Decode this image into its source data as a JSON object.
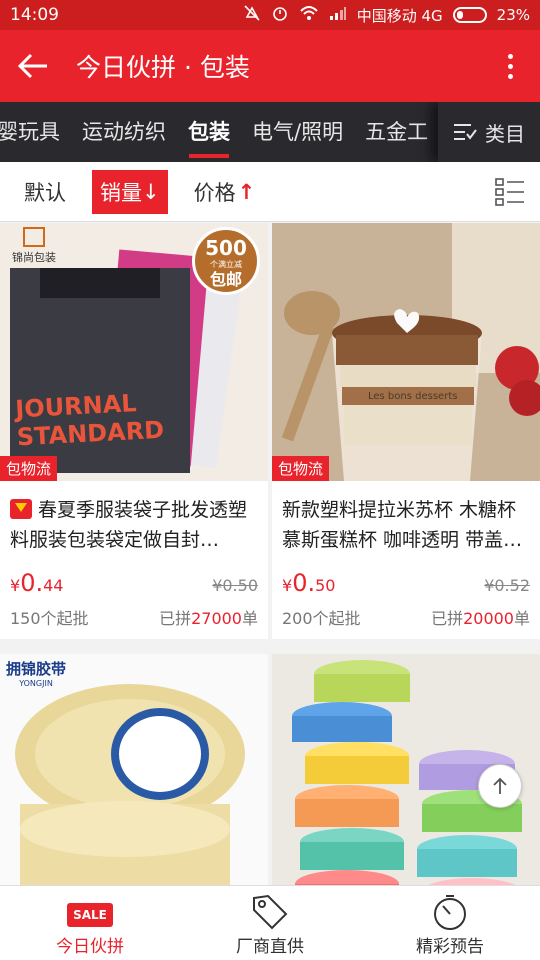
{
  "status": {
    "time": "14:09",
    "carrier": "中国移动 4G",
    "battery": "23%"
  },
  "header": {
    "title": "今日伙拼 · 包装"
  },
  "categories": [
    "婴玩具",
    "运动纺织",
    "包装",
    "电气/照明",
    "五金工"
  ],
  "category_more_label": "类目",
  "sort": {
    "default": "默认",
    "sales": "销量",
    "sales_arrow": "↓",
    "price": "价格",
    "price_arrow": "↑"
  },
  "products": [
    {
      "title": "春夏季服装袋子批发透塑料服装包装袋定做自封…",
      "price_symbol": "¥",
      "price_int": "0.",
      "price_dec": "44",
      "old_price": "¥0.50",
      "moq": "150个起批",
      "sold_prefix": "已拼",
      "sold_count": "27000",
      "sold_suffix": "单",
      "badge": "包物流",
      "has_brand_icon": true,
      "img_brand": "锦尚包装",
      "img_promo_number": "500",
      "img_promo_small": "个满立减",
      "img_promo_text": "包邮",
      "img_shirt_text": "JOURNAL STANDARD"
    },
    {
      "title": "新款塑料提拉米苏杯 木糖杯慕斯蛋糕杯 咖啡透明 带盖…",
      "price_symbol": "¥",
      "price_int": "0.",
      "price_dec": "50",
      "old_price": "¥0.52",
      "moq": "200个起批",
      "sold_prefix": "已拼",
      "sold_count": "20000",
      "sold_suffix": "单",
      "badge": "包物流",
      "has_brand_icon": false,
      "img_cup_text": "Les bons desserts"
    },
    {
      "img_brand": "拥锦胶带",
      "img_brand_sub": "YONGJIN"
    },
    {}
  ],
  "bottom_nav": [
    {
      "label": "今日伙拼",
      "icon": "sale-icon",
      "icon_text": "SALE"
    },
    {
      "label": "厂商直供",
      "icon": "tag-icon"
    },
    {
      "label": "精彩预告",
      "icon": "stopwatch-icon"
    }
  ],
  "colors": {
    "brand_red": "#e8232c",
    "dark_bar": "#2a2a2e"
  }
}
